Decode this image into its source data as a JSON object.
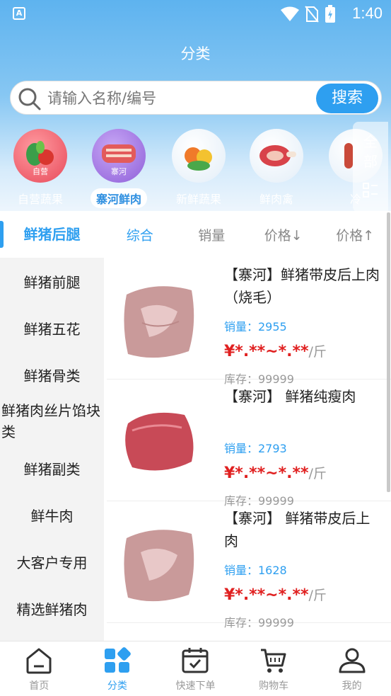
{
  "status": {
    "time": "1:40",
    "app_badge": "A"
  },
  "header": {
    "title": "分类"
  },
  "search": {
    "placeholder": "请输入名称/编号",
    "button": "搜索"
  },
  "categories": [
    {
      "label": "自营蔬果",
      "tag": "自营"
    },
    {
      "label": "寨河鲜肉",
      "tag": "寨河",
      "active": true
    },
    {
      "label": "新鲜蔬果",
      "tag": ""
    },
    {
      "label": "鲜肉禽",
      "tag": ""
    },
    {
      "label": "冷",
      "tag": ""
    }
  ],
  "all_button": {
    "line1": "全",
    "line2": "部"
  },
  "sidebar": {
    "active": "鲜猪后腿",
    "items": [
      "鲜猪前腿",
      "鲜猪五花",
      "鲜猪骨类",
      "鲜猪肉丝片馅块类",
      "鲜猪副类",
      "鲜牛肉",
      "大客户专用",
      "精选鲜猪肉"
    ]
  },
  "sort": [
    "综合",
    "销量",
    "价格↓",
    "价格↑"
  ],
  "products": [
    {
      "name": "【寨河】鲜猪带皮后上肉（烧毛）",
      "sales": "销量：2955",
      "price": "¥*.**~*.**",
      "unit": "/斤",
      "stock": "库存：99999"
    },
    {
      "name": "【寨河】 鲜猪纯瘦肉",
      "sales": "销量：2793",
      "price": "¥*.**~*.**",
      "unit": "/斤",
      "stock": "库存：99999"
    },
    {
      "name": "【寨河】 鲜猪带皮后上肉",
      "sales": "销量：1628",
      "price": "¥*.**~*.**",
      "unit": "/斤",
      "stock": "库存：99999"
    }
  ],
  "tabs": [
    "首页",
    "分类",
    "快速下单",
    "购物车",
    "我的"
  ],
  "colors": {
    "accent": "#2e9ff0",
    "price": "#e02020"
  }
}
